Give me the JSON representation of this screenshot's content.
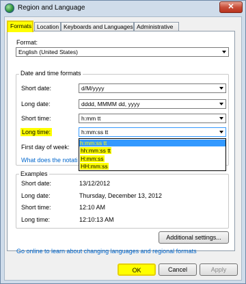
{
  "window": {
    "title": "Region and Language",
    "close": "✕"
  },
  "tabs": [
    "Formats",
    "Location",
    "Keyboards and Languages",
    "Administrative"
  ],
  "format": {
    "label": "Format:",
    "value": "English (United States)"
  },
  "date_time": {
    "group_title": "Date and time formats",
    "short_date": {
      "label": "Short date:",
      "value": "d/M/yyyy"
    },
    "long_date": {
      "label": "Long date:",
      "value": "dddd, MMMM dd, yyyy"
    },
    "short_time": {
      "label": "Short time:",
      "value": "h:mm tt"
    },
    "long_time": {
      "label": "Long time:",
      "value": "h:mm:ss tt"
    },
    "first_day": {
      "label": "First day of week:"
    },
    "notation_link": "What does the notati",
    "dropdown_options": [
      "h:mm:ss tt",
      "hh:mm:ss tt",
      "H:mm:ss",
      "HH:mm:ss"
    ]
  },
  "examples": {
    "group_title": "Examples",
    "short_date": {
      "label": "Short date:",
      "value": "13/12/2012"
    },
    "long_date": {
      "label": "Long date:",
      "value": "Thursday, December 13, 2012"
    },
    "short_time": {
      "label": "Short time:",
      "value": "12:10 AM"
    },
    "long_time": {
      "label": "Long time:",
      "value": "12:10:13 AM"
    }
  },
  "additional_settings": "Additional settings...",
  "online_link": "Go online to learn about changing languages and regional formats",
  "buttons": {
    "ok": "OK",
    "cancel": "Cancel",
    "apply": "Apply"
  },
  "colors": {
    "highlight": "#ffff00",
    "selection": "#3399ff",
    "link": "#0066cc"
  }
}
